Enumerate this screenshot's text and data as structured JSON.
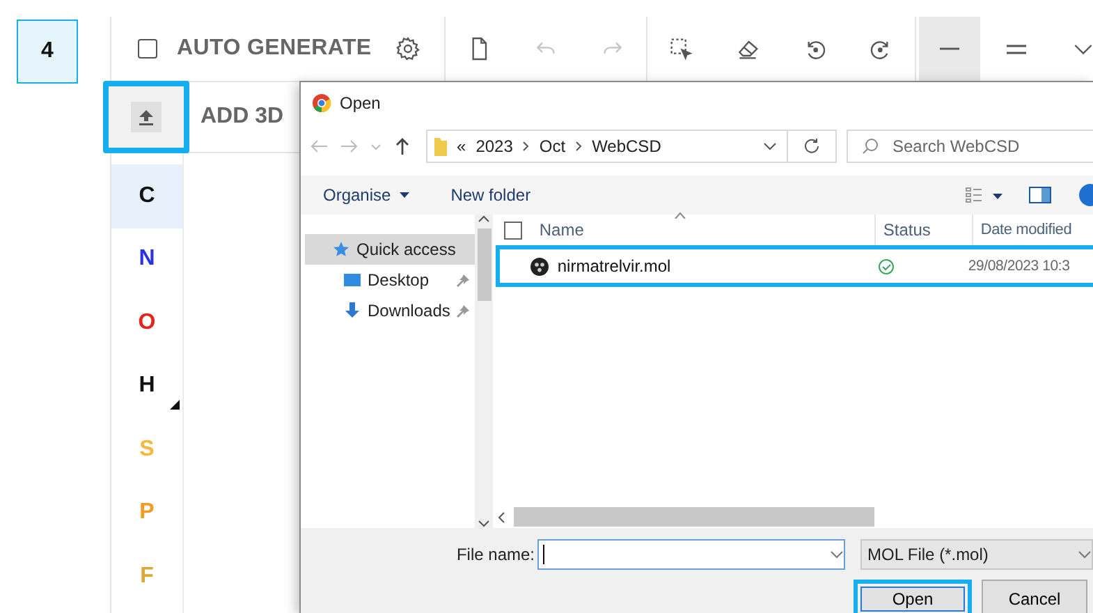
{
  "step_badge": "4",
  "toolbar": {
    "auto_generate": {
      "label": "AUTO GENERATE",
      "checked": false
    },
    "groups": [
      [
        {
          "kind": "settings",
          "selected": false,
          "disabled": false
        }
      ],
      [
        {
          "kind": "new-file",
          "selected": false,
          "disabled": false
        },
        {
          "kind": "undo",
          "selected": false,
          "disabled": true
        },
        {
          "kind": "redo",
          "selected": false,
          "disabled": true
        }
      ],
      [
        {
          "kind": "select",
          "selected": false,
          "disabled": false
        },
        {
          "kind": "eraser",
          "selected": false,
          "disabled": false
        },
        {
          "kind": "rotate-left",
          "selected": false,
          "disabled": false
        },
        {
          "kind": "rotate-right",
          "selected": false,
          "disabled": false
        }
      ],
      [
        {
          "kind": "single-bond",
          "selected": true,
          "disabled": false
        },
        {
          "kind": "double-bond",
          "selected": false,
          "disabled": false
        },
        {
          "kind": "expand",
          "selected": false,
          "disabled": false
        }
      ]
    ]
  },
  "import_button": {
    "highlighted": true
  },
  "add_3d": {
    "label": "ADD 3D"
  },
  "atoms": [
    {
      "symbol": "C",
      "color": "#111111",
      "selected": true,
      "submenu": false
    },
    {
      "symbol": "N",
      "color": "#2b32e0",
      "selected": false,
      "submenu": false
    },
    {
      "symbol": "O",
      "color": "#e8231b",
      "selected": false,
      "submenu": false
    },
    {
      "symbol": "H",
      "color": "#111111",
      "selected": false,
      "submenu": true
    },
    {
      "symbol": "S",
      "color": "#f5b83a",
      "selected": false,
      "submenu": false
    },
    {
      "symbol": "P",
      "color": "#f59b22",
      "selected": false,
      "submenu": false
    },
    {
      "symbol": "F",
      "color": "#dba83a",
      "selected": false,
      "submenu": false
    }
  ],
  "dialog": {
    "title": "Open",
    "path": {
      "prefix": "«",
      "segments": [
        "2023",
        "Oct",
        "WebCSD"
      ]
    },
    "search": {
      "placeholder": "Search WebCSD"
    },
    "commands": [
      {
        "label": "Organise",
        "menu": true
      },
      {
        "label": "New folder",
        "menu": false
      }
    ],
    "nav_tree": [
      {
        "label": "Quick access",
        "kind": "star",
        "selected": true,
        "children": [
          {
            "label": "Desktop",
            "kind": "desktop",
            "selected": false,
            "pinned": true
          },
          {
            "label": "Downloads",
            "kind": "download",
            "selected": false,
            "pinned": true
          }
        ]
      }
    ],
    "select_all": {
      "checked": false
    },
    "columns": [
      "Name",
      "Status",
      "Date modified"
    ],
    "files": [
      {
        "name": "nirmatrelvir.mol",
        "synced": true,
        "date": "29/08/2023 10:3",
        "highlighted": true
      }
    ],
    "file_name": {
      "label": "File name:"
    },
    "filter": "MOL File (*.mol)",
    "buttons": [
      {
        "label": "Open",
        "default": true,
        "highlighted": true
      },
      {
        "label": "Cancel",
        "default": false,
        "highlighted": false
      }
    ]
  }
}
